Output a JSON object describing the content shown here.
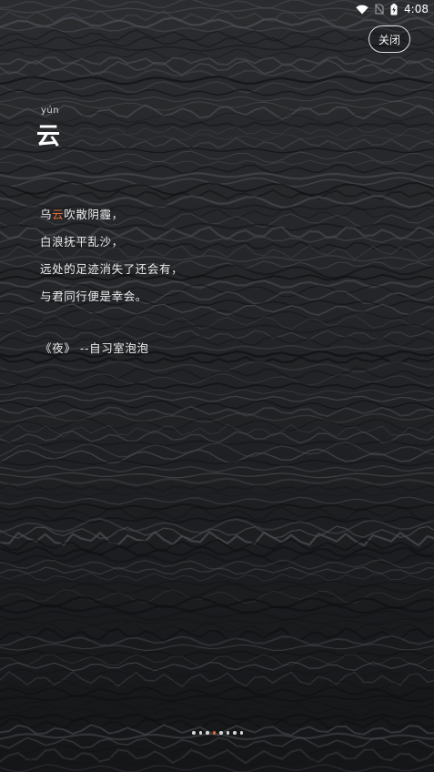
{
  "status_bar": {
    "time": "4:08",
    "icons": [
      "wifi-icon",
      "no-sim-icon",
      "battery-charging-icon"
    ]
  },
  "close_button": {
    "label": "关闭"
  },
  "word": {
    "pinyin": "yún",
    "character": "云"
  },
  "poem": {
    "lines": [
      {
        "before": "乌",
        "highlight": "云",
        "after": "吹散阴霾，"
      },
      {
        "before": "白浪抚平乱沙，",
        "highlight": "",
        "after": ""
      },
      {
        "before": "远处的足迹消失了还会有，",
        "highlight": "",
        "after": ""
      },
      {
        "before": "与君同行便是幸会。",
        "highlight": "",
        "after": ""
      }
    ],
    "source": "《夜》 --自习室泡泡"
  },
  "pager": {
    "count": 8,
    "active_index": 3
  },
  "colors": {
    "highlight": "#e06b3a",
    "background": "#1b1c1e",
    "text": "#ececec"
  }
}
